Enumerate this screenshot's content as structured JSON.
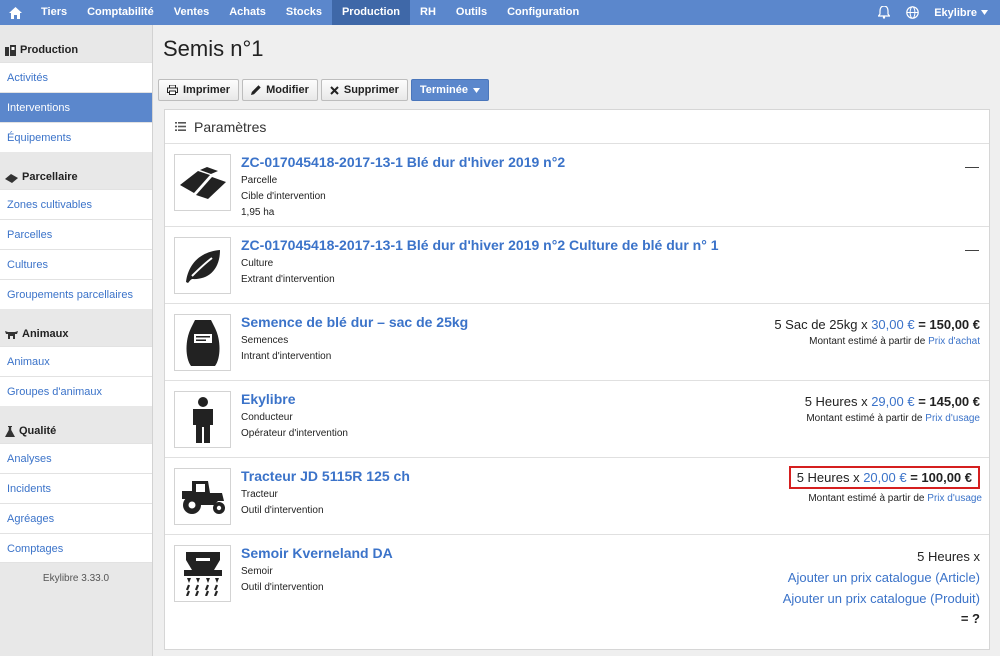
{
  "topnav": {
    "items": [
      "Tiers",
      "Comptabilité",
      "Ventes",
      "Achats",
      "Stocks",
      "Production",
      "RH",
      "Outils",
      "Configuration"
    ],
    "active": "Production",
    "user": "Ekylibre"
  },
  "sidebar": {
    "sections": [
      {
        "title": "Production",
        "items": [
          "Activités",
          "Interventions",
          "Équipements"
        ]
      },
      {
        "title": "Parcellaire",
        "items": [
          "Zones cultivables",
          "Parcelles",
          "Cultures",
          "Groupements parcellaires"
        ]
      },
      {
        "title": "Animaux",
        "items": [
          "Animaux",
          "Groupes d'animaux"
        ]
      },
      {
        "title": "Qualité",
        "items": [
          "Analyses",
          "Incidents",
          "Agréages",
          "Comptages"
        ]
      }
    ],
    "active": "Interventions",
    "version": "Ekylibre 3.33.0"
  },
  "page": {
    "title": "Semis n°1",
    "toolbar": {
      "print": "Imprimer",
      "edit": "Modifier",
      "delete": "Supprimer",
      "status": "Terminée"
    }
  },
  "panel": {
    "title": "Paramètres",
    "rows": [
      {
        "title": "ZC-017045418-2017-13-1 Blé dur d'hiver 2019 n°2",
        "lines": [
          "Parcelle",
          "Cible d'intervention",
          "1,95 ha"
        ],
        "icon": "field-icon",
        "collapse": "—"
      },
      {
        "title": "ZC-017045418-2017-13-1 Blé dur d'hiver 2019 n°2 Culture de blé dur n° 1",
        "lines": [
          "Culture",
          "Extrant d'intervention"
        ],
        "icon": "leaf-icon",
        "collapse": "—"
      },
      {
        "title": "Semence de blé dur – sac de 25kg",
        "lines": [
          "Semences",
          "Intrant d'intervention"
        ],
        "icon": "seed-bag-icon",
        "cost": {
          "qty": "5 Sac de 25kg x ",
          "price": "30,00 €",
          "total": "= 150,00 €",
          "note": "Montant estimé à partir de ",
          "note_link": "Prix d'achat"
        }
      },
      {
        "title": "Ekylibre",
        "lines": [
          "Conducteur",
          "Opérateur d'intervention"
        ],
        "icon": "person-icon",
        "cost": {
          "qty": "5 Heures x ",
          "price": "29,00 €",
          "total": "= 145,00 €",
          "note": "Montant estimé à partir de ",
          "note_link": "Prix d'usage"
        }
      },
      {
        "title": "Tracteur JD 5115R 125 ch",
        "lines": [
          "Tracteur",
          "Outil d'intervention"
        ],
        "icon": "tractor-icon",
        "cost": {
          "qty": "5 Heures x ",
          "price": "20,00 €",
          "total": "= 100,00 €",
          "note": "Montant estimé à partir de ",
          "note_link": "Prix d'usage"
        }
      },
      {
        "title": "Semoir Kverneland DA",
        "lines": [
          "Semoir",
          "Outil d'intervention"
        ],
        "icon": "seeder-icon",
        "cost": {
          "qty": "5 Heures x",
          "link1": "Ajouter un prix catalogue (Article)",
          "link2": "Ajouter un prix catalogue (Produit)",
          "total": "= ?"
        }
      }
    ]
  }
}
